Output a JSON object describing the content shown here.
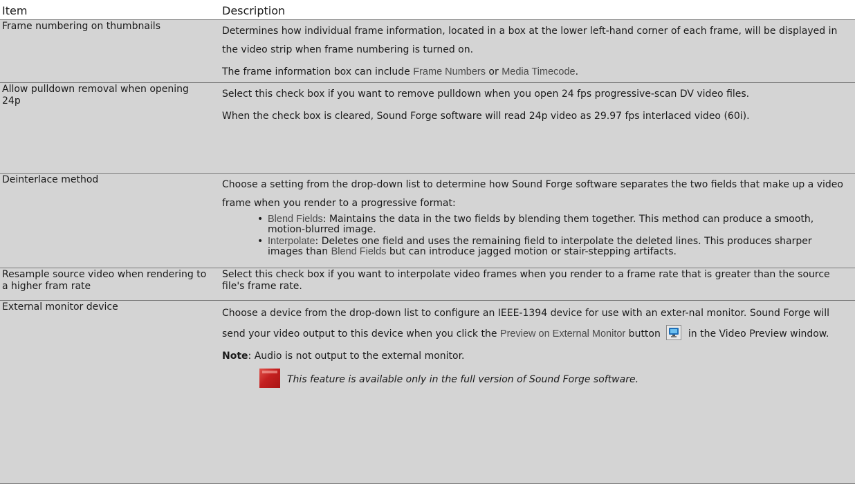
{
  "header": {
    "item_label": "Item",
    "description_label": "Description"
  },
  "rows": [
    {
      "item": "Frame numbering on thumbnails",
      "p1": "Determines how individual frame information, located in a box at the lower left-hand corner of each frame, will be displayed in the video strip when frame numbering is turned on.",
      "p2_a": "The frame information box can include ",
      "p2_b": "Frame Numbers",
      "p2_c": " or ",
      "p2_d": "Media Timecode",
      "p2_e": "."
    },
    {
      "item": "Allow pulldown removal when opening 24p",
      "p1": "Select this check box if you want to remove pulldown when you open 24 fps progressive-scan DV video files.",
      "p2": "When the check box is cleared, Sound Forge software will read 24p video as 29.97 fps interlaced video (60i)."
    },
    {
      "item": "Deinterlace method",
      "p1": "Choose a setting from the drop-down list to determine how Sound Forge software separates the two fields that make up a video frame when you render to a progressive format:",
      "bullets": [
        {
          "term": "Blend Fields",
          "text": ": Maintains the data in the two fields by blending them together. This method can produce a smooth, motion-blurred image."
        },
        {
          "term": "Interpolate",
          "text_a": ": Deletes one field and uses the remaining field to interpolate the deleted lines. This produces sharper images than ",
          "term2": "Blend Fields",
          "text_b": " but can introduce jagged motion or stair-stepping artifacts."
        }
      ]
    },
    {
      "item": "Resample source video when rendering to a higher fram rate",
      "p1": "Select this check box if you want to interpolate video frames when you render to a frame rate that is greater than the source file's frame rate."
    },
    {
      "item": "External monitor device",
      "p1_a": "Choose a device from the drop-down list to configure an IEEE-1394 device for use with an exter-nal monitor. Sound Forge will send your video output to this device when you click the ",
      "p1_b": "Preview on External Monitor",
      "p1_c": " button",
      "p1_d": "in the Video Preview window.",
      "note_label": "Note",
      "note_text": ": Audio is not output to the external monitor.",
      "full_version": "This feature is available only in the full version of Sound Forge software."
    }
  ],
  "icons": {
    "monitor_button": "monitor-icon",
    "full_version_icon": "full-version-icon",
    "accent": "#2a86c8"
  }
}
